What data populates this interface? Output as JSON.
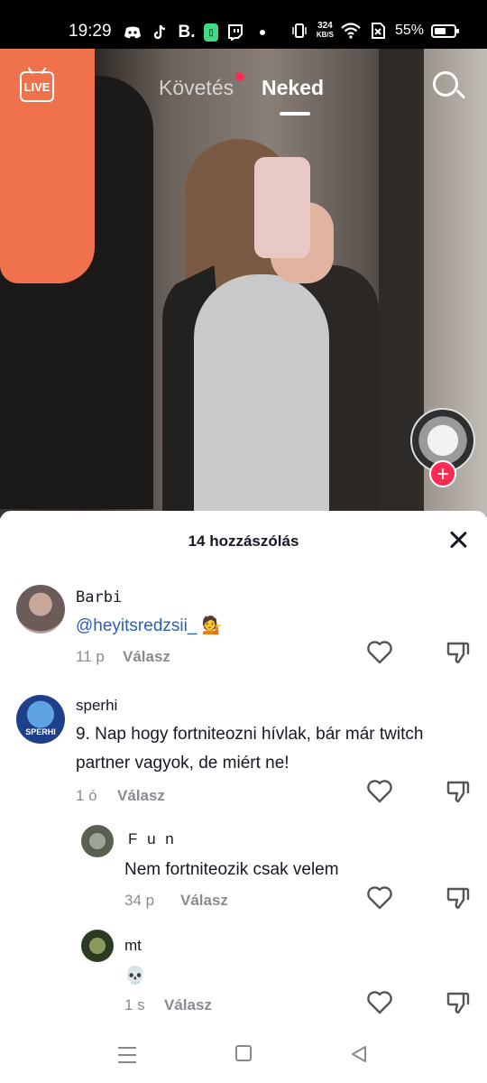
{
  "status_bar": {
    "time": "19:29",
    "app_icons": [
      "discord-icon",
      "tiktok-icon",
      "b-icon",
      "phone-app-icon",
      "twitch-icon"
    ],
    "b_label": "B.",
    "net_speed_value": "324",
    "net_speed_unit": "KB/S",
    "battery": "55%"
  },
  "top_nav": {
    "live_label": "LIVE",
    "tabs": [
      {
        "label": "Követés",
        "active": false,
        "notification_dot": true
      },
      {
        "label": "Neked",
        "active": true
      }
    ]
  },
  "comments_sheet": {
    "title": "14 hozzászólás",
    "comments": [
      {
        "username": "Barbi",
        "text": "@heyitsredzsii_ 💁",
        "mention": "@heyitsredzsii_",
        "emoji": "💁",
        "age": "11 p",
        "reply_label": "Válasz"
      },
      {
        "username": "sperhi",
        "text": "9. Nap hogy fortniteozni hívlak, bár már twitch partner vagyok, de miért ne!",
        "avatar_text": "SPERHI",
        "age": "1 ó",
        "reply_label": "Válasz"
      },
      {
        "username": "F u n",
        "text": "Nem fortniteozik csak velem",
        "age": "34 p",
        "reply_label": "Válasz",
        "is_reply": true
      },
      {
        "username": "mt",
        "text": "💀",
        "age": "1 s",
        "reply_label": "Válasz",
        "is_reply": true
      }
    ]
  },
  "colors": {
    "accent_red": "#fe2c55",
    "mention_blue": "#2b5db9",
    "meta_gray": "#8a8b91"
  }
}
